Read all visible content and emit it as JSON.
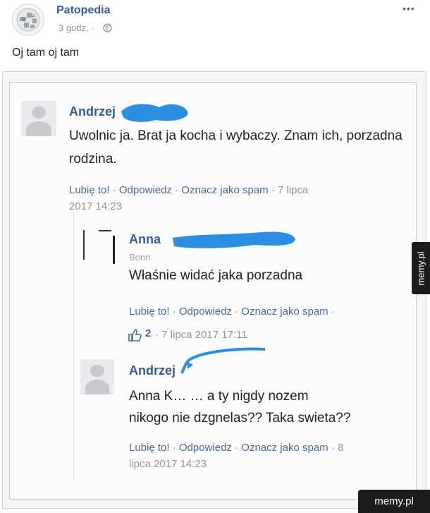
{
  "post": {
    "page_name": "Patopedia",
    "time": "3 godz. ·",
    "text": "Oj tam oj tam"
  },
  "comment1": {
    "name": "Andrzej",
    "text": "Uwolnic ja. Brat ja kocha i wybaczy. Znam ich, porzadna rodzina.",
    "like": "Lubię to!",
    "reply": "Odpowiedz",
    "spam": "Oznacz jako spam",
    "date_line": "· 7 lipca",
    "date_line2": "2017 14:23"
  },
  "comment2": {
    "name": "Anna",
    "location": "Bonn",
    "text": "Właśnie widać jaka porzadna",
    "like": "Lubię to!",
    "reply": "Odpowiedz",
    "spam": "Oznacz jako spam",
    "likes": "2",
    "date": "· 7 lipca 2017 17:11"
  },
  "comment3": {
    "name": "Andrzej",
    "text_line1": "Anna K… … a ty nigdy nozem",
    "text_line2": "nikogo nie dzgnelas?? Taka swieta??",
    "like": "Lubię to!",
    "reply": "Odpowiedz",
    "spam": "Oznacz jako spam",
    "date_line": "· 8",
    "date_line2": "lipca 2017 14:23"
  },
  "watermark": {
    "side": "memy.pl",
    "bottom": "memy.pl"
  },
  "colors": {
    "link": "#3b5998",
    "redaction": "#2a8fe0",
    "meta": "#90949c"
  },
  "icons": [
    "wikipedia-globe-icon",
    "globe-icon",
    "more-icon",
    "thumbs-up-icon"
  ]
}
